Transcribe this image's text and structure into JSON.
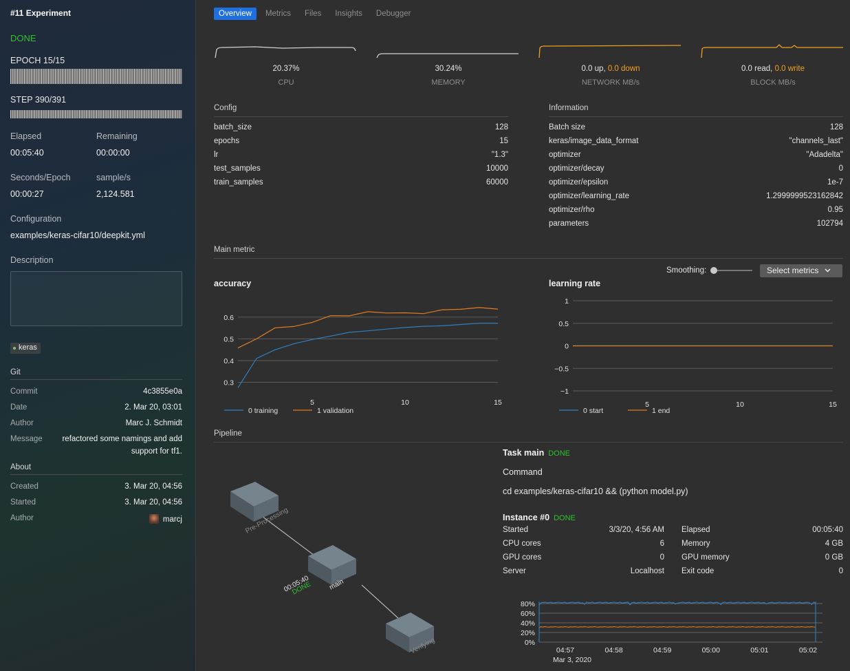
{
  "sidebar": {
    "title": "#11 Experiment",
    "status": "DONE",
    "epoch": "EPOCH 15/15",
    "epoch_progress": 1.0,
    "step": "STEP 390/391",
    "step_progress": 0.997,
    "elapsed_label": "Elapsed",
    "elapsed": "00:05:40",
    "remaining_label": "Remaining",
    "remaining": "00:00:00",
    "spe_label": "Seconds/Epoch",
    "spe": "00:00:27",
    "sps_label": "sample/s",
    "sps": "2,124.581",
    "config_label": "Configuration",
    "config_path": "examples/keras-cifar10/deepkit.yml",
    "description_label": "Description",
    "description": "",
    "tag": "keras",
    "git": {
      "heading": "Git",
      "commit_label": "Commit",
      "commit": "4c3855e0a",
      "date_label": "Date",
      "date": "2. Mar 20, 03:01",
      "author_label": "Author",
      "author": "Marc J. Schmidt",
      "message_label": "Message",
      "message_line1": "refactored some namings and add",
      "message_line2": "support for tf1."
    },
    "about": {
      "heading": "About",
      "created_label": "Created",
      "created": "3. Mar 20, 04:56",
      "started_label": "Started",
      "started": "3. Mar 20, 04:56",
      "author_label": "Author",
      "author": "marcj"
    }
  },
  "tabs": [
    "Overview",
    "Metrics",
    "Files",
    "Insights",
    "Debugger"
  ],
  "active_tab": "Overview",
  "gauges": {
    "cpu": {
      "value": "20.37%",
      "label": "CPU"
    },
    "memory": {
      "value": "30.24%",
      "label": "MEMORY"
    },
    "network": {
      "up": "0.0 up,",
      "down": "0.0 down",
      "label": "NETWORK MB/s"
    },
    "block": {
      "read": "0.0 read,",
      "write": "0.0 write",
      "label": "BLOCK MB/s"
    }
  },
  "config": {
    "heading": "Config",
    "rows": [
      {
        "k": "batch_size",
        "v": "128"
      },
      {
        "k": "epochs",
        "v": "15"
      },
      {
        "k": "lr",
        "v": "\"1.3\""
      },
      {
        "k": "test_samples",
        "v": "10000"
      },
      {
        "k": "train_samples",
        "v": "60000"
      }
    ]
  },
  "information": {
    "heading": "Information",
    "rows": [
      {
        "k": "Batch size",
        "v": "128"
      },
      {
        "k": "keras/image_data_format",
        "v": "\"channels_last\""
      },
      {
        "k": "optimizer",
        "v": "\"Adadelta\""
      },
      {
        "k": "optimizer/decay",
        "v": "0"
      },
      {
        "k": "optimizer/epsilon",
        "v": "1e-7"
      },
      {
        "k": "optimizer/learning_rate",
        "v": "1.2999999523162842"
      },
      {
        "k": "optimizer/rho",
        "v": "0.95"
      },
      {
        "k": "parameters",
        "v": "102794"
      }
    ]
  },
  "main_metric": {
    "heading": "Main metric",
    "smoothing_label": "Smoothing:",
    "smoothing_value": 0,
    "select_label": "Select metrics"
  },
  "colors": {
    "blue": "#2f7fc1",
    "orange": "#e07b1f",
    "green": "#2fc12f",
    "accent": "#1f6fe0"
  },
  "chart_data": [
    {
      "type": "line",
      "title": "accuracy",
      "x": [
        1,
        2,
        3,
        4,
        5,
        6,
        7,
        8,
        9,
        10,
        11,
        12,
        13,
        14,
        15
      ],
      "xticks": [
        5,
        10,
        15
      ],
      "yticks": [
        0.3,
        0.4,
        0.5,
        0.6
      ],
      "ylim": [
        0.27,
        0.65
      ],
      "series": [
        {
          "name": "0 training",
          "color": "#2f7fc1",
          "values": [
            0.275,
            0.41,
            0.45,
            0.477,
            0.497,
            0.513,
            0.53,
            0.537,
            0.545,
            0.552,
            0.558,
            0.56,
            0.566,
            0.572,
            0.572
          ]
        },
        {
          "name": "1 validation",
          "color": "#e07b1f",
          "values": [
            0.458,
            0.5,
            0.551,
            0.557,
            0.576,
            0.607,
            0.606,
            0.625,
            0.619,
            0.62,
            0.616,
            0.634,
            0.636,
            0.644,
            0.637
          ]
        }
      ]
    },
    {
      "type": "line",
      "title": "learning rate",
      "x": [
        1,
        2,
        3,
        4,
        5,
        6,
        7,
        8,
        9,
        10,
        11,
        12,
        13,
        14,
        15
      ],
      "xticks": [
        5,
        10,
        15
      ],
      "yticks": [
        1,
        0.5,
        0,
        -0.5,
        -1
      ],
      "ytick_labels": [
        "1",
        "0.5",
        "0",
        "−0.5",
        "−1"
      ],
      "ylim": [
        -1,
        1
      ],
      "series": [
        {
          "name": "0 start",
          "color": "#2f7fc1",
          "values": [
            0,
            0,
            0,
            0,
            0,
            0,
            0,
            0,
            0,
            0,
            0,
            0,
            0,
            0,
            0
          ]
        },
        {
          "name": "1 end",
          "color": "#e07b1f",
          "values": [
            0,
            0,
            0,
            0,
            0,
            0,
            0,
            0,
            0,
            0,
            0,
            0,
            0,
            0,
            0
          ]
        }
      ]
    },
    {
      "type": "line",
      "title": "",
      "x": [
        "04:57",
        "04:58",
        "04:59",
        "05:00",
        "05:01",
        "05:02"
      ],
      "x_sublabel": "Mar 3, 2020",
      "ytick_labels": [
        "80%",
        "60%",
        "40%",
        "20%",
        "0%"
      ],
      "yticks": [
        80,
        60,
        40,
        20,
        0
      ],
      "ylim": [
        0,
        90
      ],
      "series": [
        {
          "name": "",
          "color": "#2f7fc1",
          "values": [
            83,
            82,
            83,
            82,
            83,
            82
          ]
        },
        {
          "name": "",
          "color": "#e07b1f",
          "values": [
            32,
            31,
            32,
            31,
            32,
            31
          ]
        }
      ]
    }
  ],
  "pipeline": {
    "heading": "Pipeline",
    "nodes": [
      {
        "name": "Pre-Processing"
      },
      {
        "name": "main",
        "time": "00:05:40",
        "status": "DONE"
      },
      {
        "name": "Verifying"
      }
    ],
    "task": {
      "title": "Task main",
      "status": "DONE",
      "command_label": "Command",
      "command": "cd examples/keras-cifar10 && (python model.py)"
    },
    "instance": {
      "title": "Instance #0",
      "status": "DONE",
      "left": [
        {
          "k": "Started",
          "v": "3/3/20, 4:56 AM"
        },
        {
          "k": "CPU cores",
          "v": "6"
        },
        {
          "k": "GPU cores",
          "v": "0"
        },
        {
          "k": "Server",
          "v": "Localhost"
        }
      ],
      "right": [
        {
          "k": "Elapsed",
          "v": "00:05:40"
        },
        {
          "k": "Memory",
          "v": "4 GB"
        },
        {
          "k": "GPU memory",
          "v": "0 GB"
        },
        {
          "k": "Exit code",
          "v": "0"
        }
      ]
    }
  }
}
